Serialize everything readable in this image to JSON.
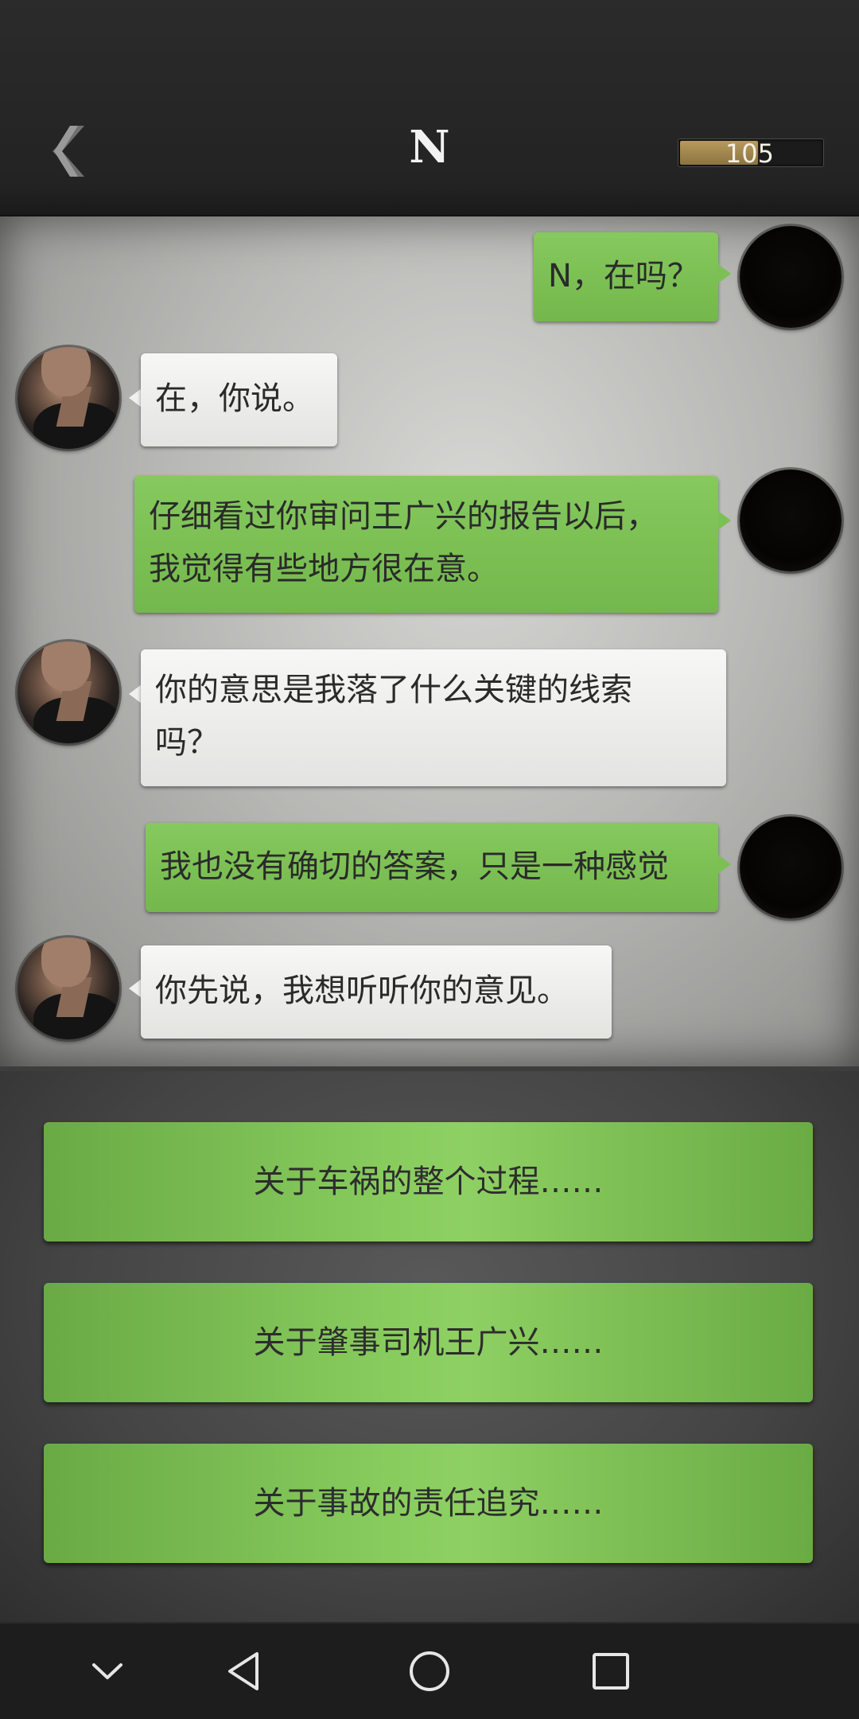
{
  "header": {
    "title": "N",
    "energy_value": "105",
    "energy_fraction": 0.55,
    "back_icon": "chevron-left-icon"
  },
  "messages": [
    {
      "side": "me",
      "text": "N，在吗？"
    },
    {
      "side": "them",
      "text": "在，你说。"
    },
    {
      "side": "me",
      "lines": [
        "仔细看过你审问王广兴的报告以后，",
        "我觉得有些地方很在意。"
      ]
    },
    {
      "side": "them",
      "lines": [
        "你的意思是我落了什么关键的线索",
        "吗？"
      ]
    },
    {
      "side": "me",
      "text": "我也没有确切的答案，只是一种感觉"
    },
    {
      "side": "them",
      "text": "你先说，我想听听你的意见。"
    }
  ],
  "options": [
    {
      "label": "关于车祸的整个过程……"
    },
    {
      "label": "关于肇事司机王广兴……"
    },
    {
      "label": "关于事故的责任追究……"
    }
  ],
  "navbar": {
    "icons": [
      "chevron-down-icon",
      "back-triangle-icon",
      "home-circle-icon",
      "recents-square-icon"
    ]
  },
  "colors": {
    "my_bubble": "#7cc055",
    "their_bubble": "#f0f0ee",
    "option": "#88cc5e"
  }
}
